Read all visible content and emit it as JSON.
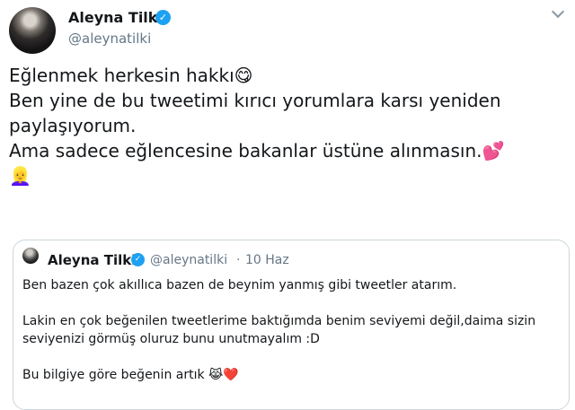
{
  "tweet": {
    "author_name": "Aleyna Tilki",
    "handle": "@aleynatilki",
    "lines": [
      "Eğlenmek herkesin hakkı",
      "Ben yine de bu tweetimi kırıcı yorumlara karsı yeniden",
      "paylaşıyorum.",
      "Ama sadece eğlencesine bakanlar üstüne alınmasın."
    ],
    "emoji_icons": [
      "face-savoring-food-icon",
      "two-hearts-icon",
      "person-blond-hair-icon"
    ]
  },
  "quoted": {
    "author_name": "Aleyna Tilki",
    "handle": "@aleynatilki",
    "separator": "·",
    "date": "10 Haz",
    "lines": [
      "Ben bazen çok akıllıca bazen de beynim yanmış gibi tweetler atarım.",
      "Lakin en çok beğenilen tweetlerime baktığımda benim seviyemi değil,daima sizin",
      "seviyenizi görmüş oluruz bunu unutmayalım :D",
      "Bu bilgiye göre beğenin artık"
    ],
    "emoji_icons": [
      "face-with-tears-of-joy-icon",
      "red-heart-icon"
    ]
  },
  "colors": {
    "verified": "#1da1f2",
    "secondary_text": "#657786",
    "border": "#ccd6dd"
  }
}
